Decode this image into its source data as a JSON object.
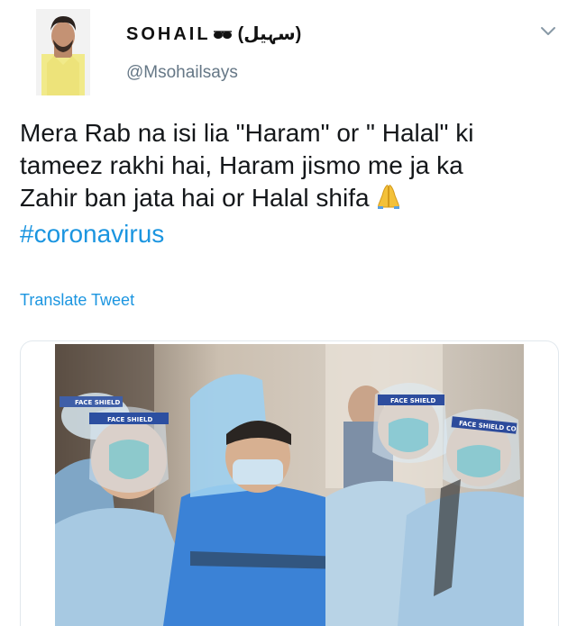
{
  "author": {
    "name": "SOHAIL",
    "name_urdu": "(سہیل)",
    "handle": "@Msohailsays",
    "glasses_icon": "sunglasses-emoji"
  },
  "tweet": {
    "lines": [
      "Mera Rab na isi lia \"Haram\" or \" Halal\" ki",
      "tameez rakhi hai, Haram jismo me ja ka",
      "Zahir ban jata hai or Halal shifa"
    ],
    "hashtag": "#coronavirus",
    "emoji": "folded-hands-emoji"
  },
  "translate_label": "Translate Tweet",
  "media": {
    "face_shield_labels": [
      "FACE SHIELD",
      "FACE SHIELD",
      "FACE SHIELD",
      "FACE SHIELD CO"
    ]
  },
  "colors": {
    "link": "#1b95e0",
    "secondary_text": "#657786",
    "text": "#14171a",
    "border": "#e1e8ed"
  }
}
